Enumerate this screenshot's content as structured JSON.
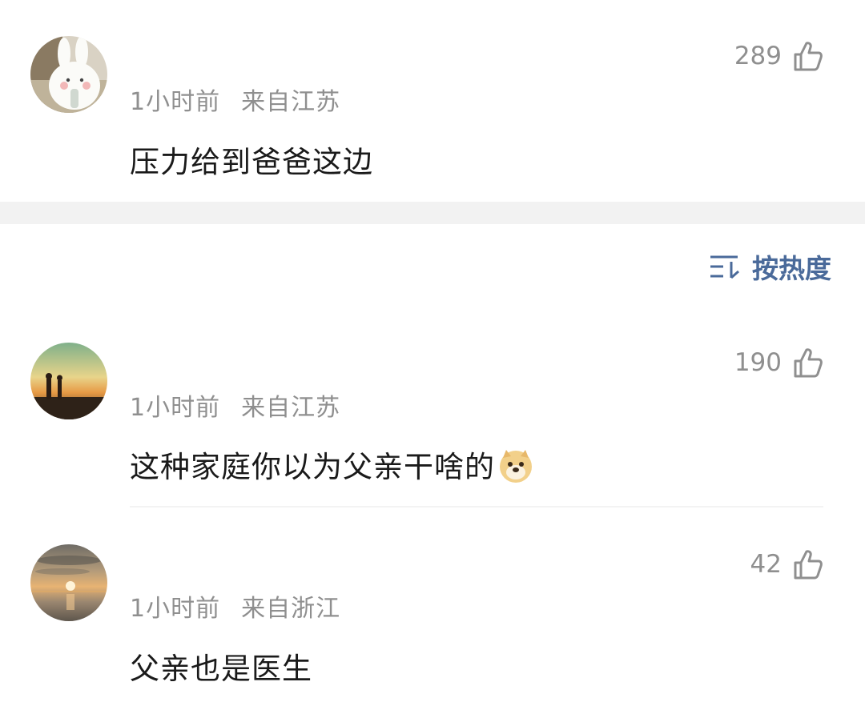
{
  "comments": [
    {
      "time": "1小时前",
      "location": "来自江苏",
      "text": "压力给到爸爸这边",
      "likes": "289",
      "avatar_icon": "cartoon-rabbit-avatar"
    },
    {
      "time": "1小时前",
      "location": "来自江苏",
      "text": "这种家庭你以为父亲干啥的",
      "likes": "190",
      "avatar_icon": "sunset-couple-avatar",
      "emoji": "doge-emoji-icon"
    },
    {
      "time": "1小时前",
      "location": "来自浙江",
      "text": "父亲也是医生",
      "likes": "42",
      "avatar_icon": "sunset-sea-avatar"
    }
  ],
  "sort": {
    "label": "按热度",
    "icon": "sort-icon"
  },
  "colors": {
    "meta_gray": "#8f8f8f",
    "text_dark": "#1a1a1a",
    "sort_blue": "#4a6a9a",
    "band_gray": "#f2f2f2"
  }
}
